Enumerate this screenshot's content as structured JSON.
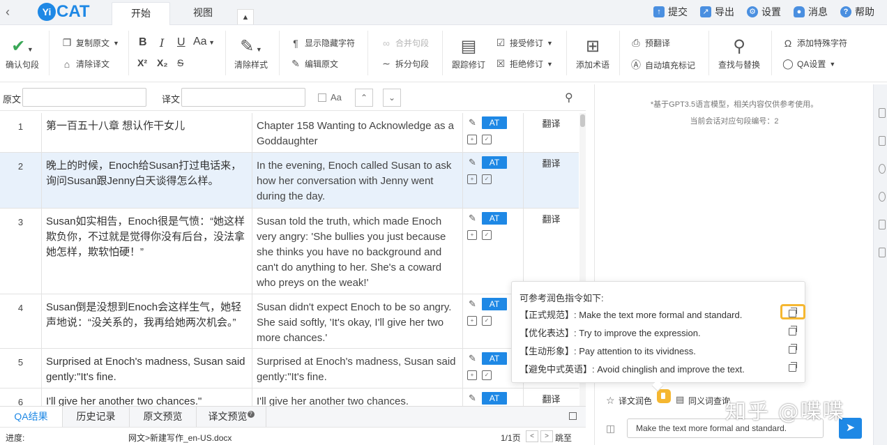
{
  "app": {
    "logo_text": "CAT",
    "logo_badge": "Yi",
    "tabs": [
      "开始",
      "视图"
    ],
    "top_actions": [
      "提交",
      "导出",
      "设置",
      "消息",
      "帮助"
    ]
  },
  "ribbon": {
    "confirm": "确认句段",
    "copy_source": "复制原文",
    "clear_target": "清除译文",
    "clear_style": "清除样式",
    "show_hidden": "显示隐藏字符",
    "edit_source": "编辑原文",
    "merge_segment": "合并句段",
    "split_segment": "拆分句段",
    "track_changes": "跟踪修订",
    "accept_changes": "接受修订",
    "reject_changes": "拒绝修订",
    "add_term": "添加术语",
    "pretranslate": "预翻译",
    "autofill_tags": "自动填充标记",
    "find_replace": "查找与替换",
    "add_special_char": "添加特殊字符",
    "qa_settings": "QA设置",
    "font_case": "Aa"
  },
  "filter": {
    "source_label": "原文",
    "target_label": "译文",
    "case_label": "Aa"
  },
  "segments": [
    {
      "num": "1",
      "source": "第一百五十八章 想认作干女儿",
      "target": "Chapter 158 Wanting to Acknowledge as a Goddaughter",
      "badge": "AT",
      "action": "翻译"
    },
    {
      "num": "2",
      "source": "晚上的时候，Enoch给Susan打过电话来，询问Susan跟Jenny白天谈得怎么样。",
      "target": "In the evening, Enoch called Susan to ask how her conversation with Jenny went during the day.",
      "badge": "AT",
      "action": "翻译"
    },
    {
      "num": "3",
      "source": "Susan如实相告，Enoch很是气愤：“她这样欺负你，不过就是觉得你没有后台，没法拿她怎样，欺软怕硬！”",
      "target": "Susan told the truth, which made Enoch very angry: 'She bullies you just because she thinks you have no background and can't do anything to her. She's a coward who preys on the weak!'",
      "badge": "AT",
      "action": "翻译"
    },
    {
      "num": "4",
      "source": "Susan倒是没想到Enoch会这样生气，她轻声地说：“没关系的，我再给她两次机会。”",
      "target": "Susan didn't expect Enoch to be so angry. She said softly, 'It's okay, I'll give her two more chances.'",
      "badge": "AT",
      "action": ""
    },
    {
      "num": "5",
      "source": "Surprised at Enoch's madness, Susan said gently:\"It's fine.",
      "target": "Surprised at Enoch's madness, Susan said gently:\"It's fine.",
      "badge": "AT",
      "action": ""
    },
    {
      "num": "6",
      "source": "I'll give her another two chances.\"",
      "target": "I'll give her another two chances.",
      "badge": "AT",
      "action": "翻译"
    }
  ],
  "bottom_tabs": [
    "QA结果",
    "历史记录",
    "原文预览",
    "译文预览"
  ],
  "status": {
    "progress_label": "进度:",
    "file_path": "网文>新建写作_en-US.docx",
    "page": "1/1页",
    "goto": "跳至"
  },
  "assistant": {
    "note_line1": "*基于GPT3.5语言模型，相关内容仅供参考使用。",
    "note_line2": "当前会话对应句段编号：2",
    "tool_polish": "译文润色",
    "tool_synonym": "同义词查询",
    "input_value": "Make the text more formal and standard.",
    "popup_title": "可参考润色指令如下:",
    "prompts": [
      {
        "tag": "【正式规范】",
        "text": ": Make the text more formal and standard."
      },
      {
        "tag": "【优化表达】",
        "text": ": Try to improve the expression."
      },
      {
        "tag": "【生动形象】",
        "text": ": Pay attention to its vividness."
      },
      {
        "tag": "【避免中式英语】",
        "text": ": Avoid chinglish and improve the text."
      }
    ]
  },
  "watermark": "知乎 @喋喋",
  "colors": {
    "accent": "#1e88e5",
    "highlight": "#f5b731",
    "selected_row": "#e8f1fb"
  }
}
